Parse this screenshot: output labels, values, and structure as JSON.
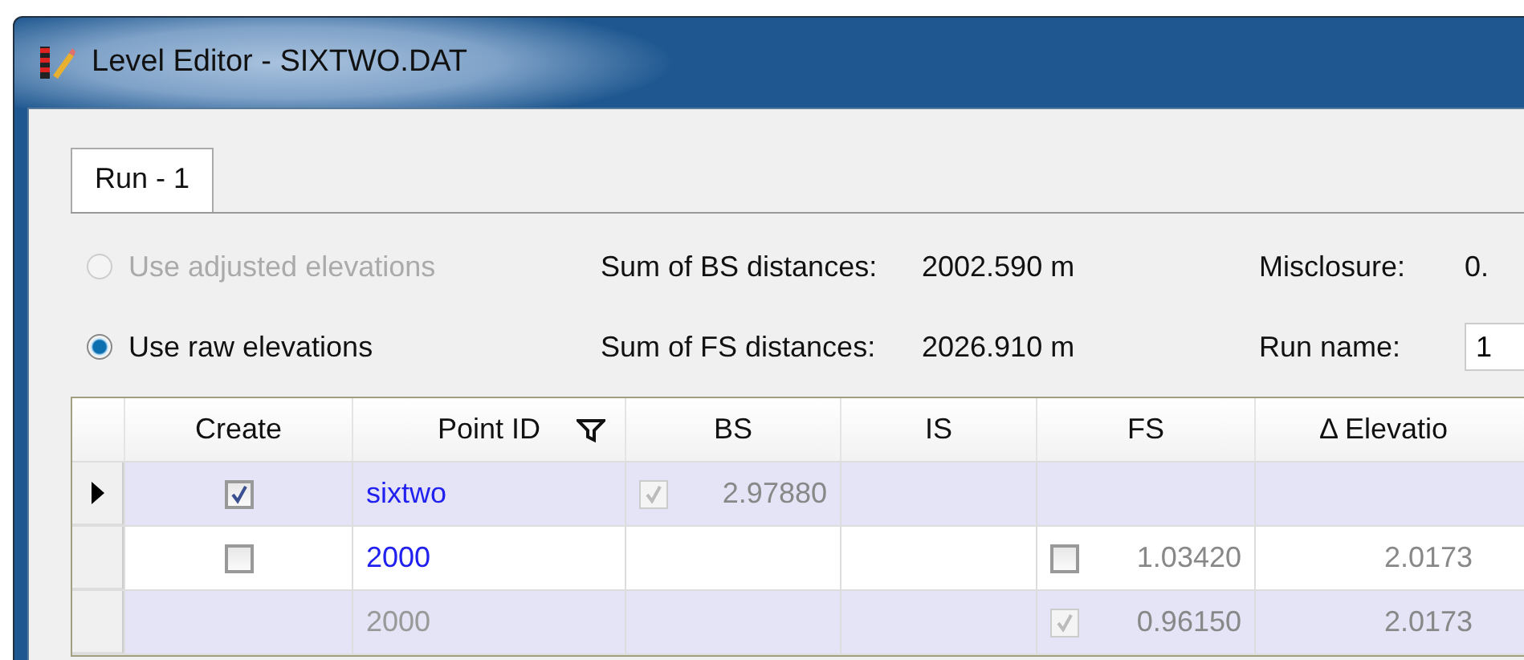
{
  "window": {
    "title": "Level Editor - SIXTWO.DAT"
  },
  "tabs": [
    {
      "label": "Run - 1",
      "selected": true
    }
  ],
  "options": [
    {
      "label": "Use adjusted elevations",
      "selected": false,
      "disabled": true
    },
    {
      "label": "Use raw elevations",
      "selected": true,
      "disabled": false
    }
  ],
  "summary": [
    {
      "label": "Sum of BS distances:",
      "value": "2002.590 m"
    },
    {
      "label": "Sum of FS distances:",
      "value": "2026.910 m"
    }
  ],
  "misclosure": {
    "label": "Misclosure:",
    "value": "0."
  },
  "run_name": {
    "label": "Run name:",
    "value": "1"
  },
  "table": {
    "columns": [
      {
        "label": "Create",
        "filter": false
      },
      {
        "label": "Point ID",
        "filter": true
      },
      {
        "label": "BS",
        "filter": false
      },
      {
        "label": "IS",
        "filter": false
      },
      {
        "label": "FS",
        "filter": false
      },
      {
        "label": "Δ Elevatio",
        "filter": false
      }
    ],
    "rows": [
      {
        "current": true,
        "create": {
          "checked": true,
          "disabled": false
        },
        "point_id": {
          "text": "sixtwo",
          "disabled": false
        },
        "bs": {
          "checkbox": {
            "checked": true,
            "disabled": true
          },
          "text": "2.97880"
        },
        "is": null,
        "fs": null,
        "delta": null
      },
      {
        "current": false,
        "create": {
          "checked": false,
          "disabled": false
        },
        "point_id": {
          "text": "2000",
          "disabled": false
        },
        "bs": null,
        "is": null,
        "fs": {
          "checkbox": {
            "checked": false,
            "disabled": false
          },
          "text": "1.03420"
        },
        "delta": "2.0173"
      },
      {
        "current": false,
        "create": null,
        "point_id": {
          "text": "2000",
          "disabled": true
        },
        "bs": null,
        "is": null,
        "fs": {
          "checkbox": {
            "checked": true,
            "disabled": true
          },
          "text": "0.96150"
        },
        "delta": "2.0173"
      }
    ]
  }
}
